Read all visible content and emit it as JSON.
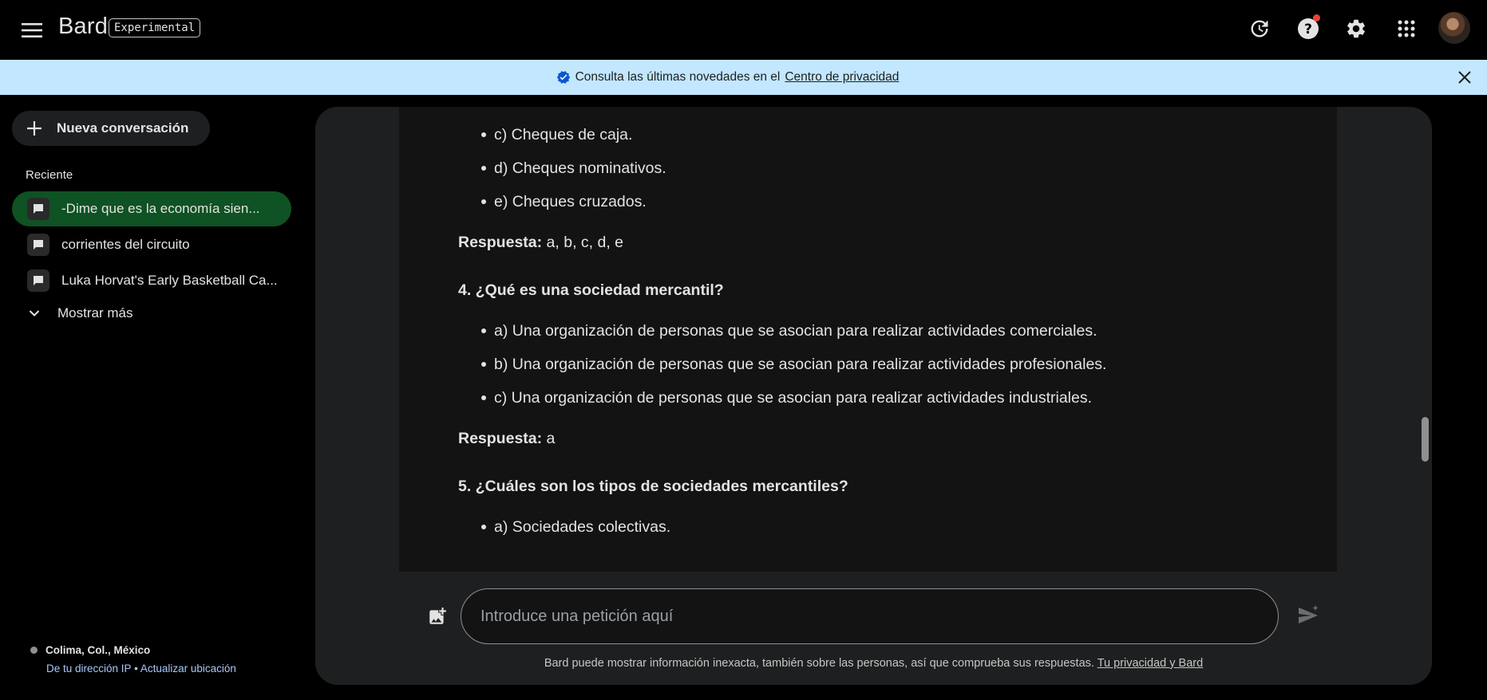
{
  "header": {
    "brand": "Bard",
    "badge": "Experimental",
    "icons": [
      "menu-icon",
      "history-icon",
      "help-icon",
      "settings-icon",
      "apps-icon",
      "avatar"
    ],
    "notification_color": "#ea4335"
  },
  "banner": {
    "text": "Consulta las últimas novedades en el",
    "link": "Centro de privacidad",
    "background": "#c2e7ff"
  },
  "sidebar": {
    "new_chat": "Nueva conversación",
    "recent_label": "Reciente",
    "conversations": [
      {
        "title": "-Dime que es la economía sien...",
        "active": true
      },
      {
        "title": "corrientes del circuito",
        "active": false
      },
      {
        "title": "Luka Horvat's Early Basketball Ca...",
        "active": false
      }
    ],
    "show_more": "Mostrar más",
    "active_color": "#0f5223",
    "location": {
      "place": "Colima, Col., México",
      "source": "De tu dirección IP",
      "separator": "•",
      "update": "Actualizar ubicación"
    }
  },
  "conversation": {
    "items_q3": [
      "c) Cheques de caja.",
      "d) Cheques nominativos.",
      "e) Cheques cruzados."
    ],
    "answer3_label": "Respuesta:",
    "answer3_value": "a, b, c, d, e",
    "question4": "4. ¿Qué es una sociedad mercantil?",
    "items_q4": [
      "a) Una organización de personas que se asocian para realizar actividades comerciales.",
      "b) Una organización de personas que se asocian para realizar actividades profesionales.",
      "c) Una organización de personas que se asocian para realizar actividades industriales."
    ],
    "answer4_label": "Respuesta:",
    "answer4_value": "a",
    "question5": "5. ¿Cuáles son los tipos de sociedades mercantiles?",
    "items_q5": [
      "a) Sociedades colectivas."
    ]
  },
  "input": {
    "placeholder": "Introduce una petición aquí"
  },
  "footer": {
    "disclaimer": "Bard puede mostrar información inexacta, también sobre las personas, así que comprueba sus respuestas.",
    "link": "Tu privacidad y Bard"
  }
}
